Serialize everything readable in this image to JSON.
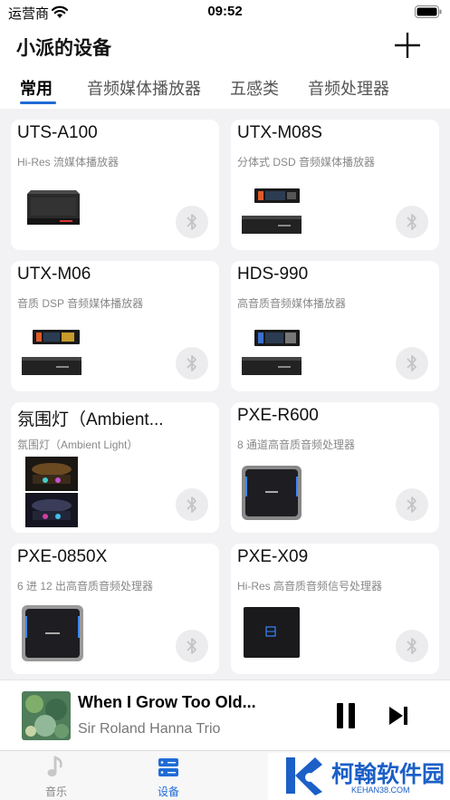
{
  "status_bar": {
    "carrier": "运营商",
    "time": "09:52"
  },
  "header": {
    "title": "小派的设备"
  },
  "tabs": [
    {
      "label": "常用",
      "active": true
    },
    {
      "label": "音频媒体播放器",
      "active": false
    },
    {
      "label": "五感类",
      "active": false
    },
    {
      "label": "音频处理器",
      "active": false
    }
  ],
  "devices": [
    {
      "name": "UTS-A100",
      "description": "Hi-Res 流媒体播放器",
      "image": "black-box-player"
    },
    {
      "name": "UTX-M08S",
      "description": "分体式 DSD 音频媒体播放器",
      "image": "head-unit-with-amp"
    },
    {
      "name": "UTX-M06",
      "description": "音质 DSP 音频媒体播放器",
      "image": "head-unit-with-amp"
    },
    {
      "name": "HDS-990",
      "description": "高音质音频媒体播放器",
      "image": "head-unit-with-amp"
    },
    {
      "name": "氛围灯（Ambient...",
      "description": "氛围灯（Ambient Light）",
      "image": "ambient-light-car-interior"
    },
    {
      "name": "PXE-R600",
      "description": "8 通道高音质音频处理器",
      "image": "square-processor"
    },
    {
      "name": "PXE-0850X",
      "description": "6 进 12 出高音质音频处理器",
      "image": "square-processor"
    },
    {
      "name": "PXE-X09",
      "description": "Hi-Res 高音质音频信号处理器",
      "image": "square-processor-dark"
    }
  ],
  "player": {
    "title": "When I Grow Too Old...",
    "artist": "Sir Roland Hanna Trio"
  },
  "tab_bar": [
    {
      "label": "音乐",
      "icon": "music-note-icon",
      "active": false
    },
    {
      "label": "设备",
      "icon": "device-icon",
      "active": true
    }
  ],
  "watermark": {
    "title": "柯翰软件园",
    "url": "KEHAN38.COM"
  },
  "colors": {
    "accent": "#1f6bd6",
    "card_bg": "#ffffff",
    "page_bg": "#f2f2f4",
    "watermark": "#1b5fc7"
  }
}
